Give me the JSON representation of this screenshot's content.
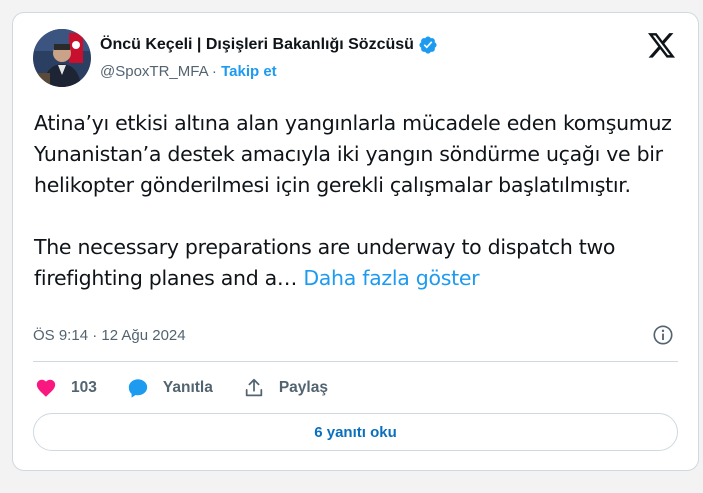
{
  "author": {
    "display_name": "Öncü Keçeli | Dışişleri Bakanlığı Sözcüsü",
    "handle": "@SpoxTR_MFA",
    "separator": " · ",
    "follow_label": "Takip et",
    "verified_icon": "verified-badge-icon"
  },
  "tweet": {
    "paragraph_1": "Atina’yı etkisi altına alan yangınlarla mücadele eden komşumuz Yunanistan’a destek amacıyla iki yangın söndürme uçağı ve bir helikopter gönderilmesi için gerekli çalışmalar başlatılmıştır.",
    "paragraph_2": "The necessary preparations are underway to dispatch two firefighting planes and a… ",
    "show_more": "Daha fazla göster",
    "timestamp": "ÖS 9:14 · 12 Ağu 2024"
  },
  "actions": {
    "like_count": "103",
    "reply_label": "Yanıtla",
    "share_label": "Paylaş"
  },
  "read_replies_label": "6 yanıtı oku",
  "colors": {
    "accent": "#1d9bf0",
    "like": "#f91880",
    "text": "#0f1419",
    "muted": "#536471"
  }
}
